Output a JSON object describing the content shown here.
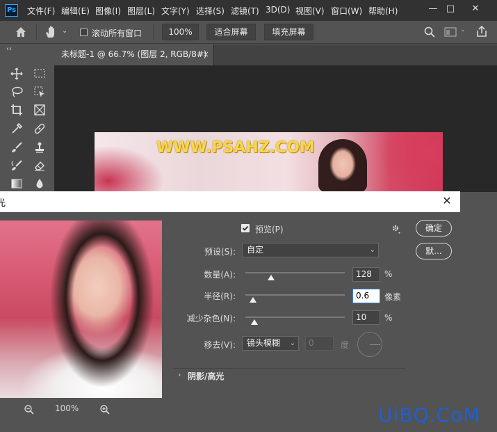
{
  "app": {
    "logo": "Ps"
  },
  "menu": [
    "文件(F)",
    "编辑(E)",
    "图像(I)",
    "图层(L)",
    "文字(Y)",
    "选择(S)",
    "滤镜(T)",
    "3D(D)",
    "视图(V)",
    "窗口(W)",
    "帮助(H)"
  ],
  "window_controls": {
    "minimize": "—",
    "maximize": "□",
    "close": "✕"
  },
  "options_bar": {
    "scroll_all_label": "滚动所有窗口",
    "zoom_value": "100%",
    "fit_screen": "适合屏幕",
    "fill_screen": "填充屏幕"
  },
  "collapse": "‹‹",
  "document": {
    "tab_title": "未标题-1 @ 66.7% (图层 2, RGB/8#) *",
    "tab_close": "×",
    "watermark": "WWW.PSAHZ.COM"
  },
  "dialog": {
    "title": "光",
    "close": "✕",
    "preview_label": "预览(P)",
    "preview_checked": true,
    "ok": "确定",
    "default": "默...",
    "preset_label": "预设(S):",
    "preset_value": "自定",
    "amount_label": "数量(A):",
    "amount_value": "128",
    "amount_unit": "%",
    "radius_label": "半径(R):",
    "radius_value": "0.6",
    "radius_unit": "像素",
    "noise_label": "减少杂色(N):",
    "noise_value": "10",
    "noise_unit": "%",
    "remove_label": "移去(V):",
    "remove_value": "镜头模糊",
    "angle_value": "0",
    "angle_unit": "度",
    "shadows_label": "阴影/高光",
    "preview_zoom": "100%"
  },
  "slider_levels": {
    "amount": 0.26,
    "radius": 0.08,
    "noise": 0.09
  },
  "site_watermark": "UiBQ.CoM",
  "colors": {
    "accent": "#31a8ff",
    "focus": "#2f86d8",
    "watermark_yellow": "#f6d84c",
    "site_blue": "#1d5fd6"
  }
}
